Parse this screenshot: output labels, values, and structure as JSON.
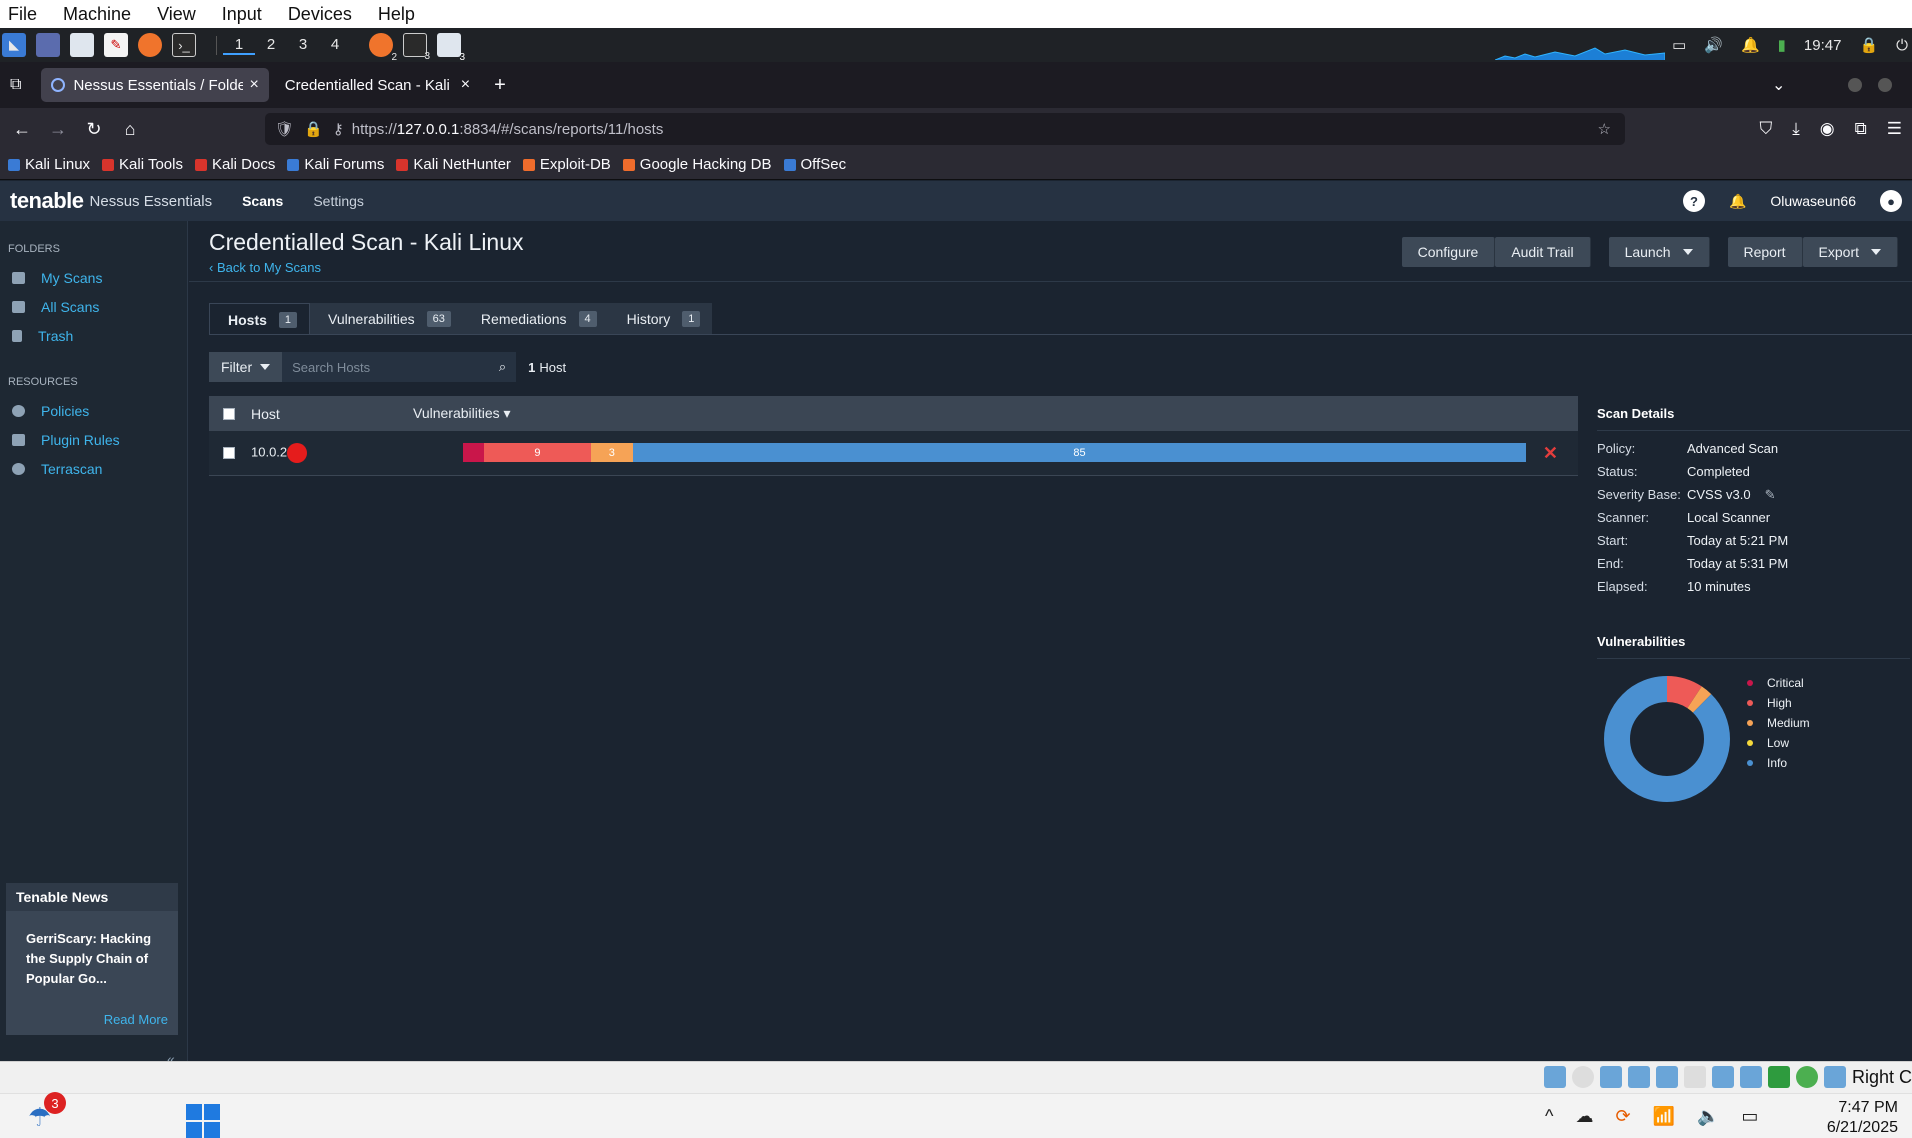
{
  "vbox_menu": [
    "File",
    "Machine",
    "View",
    "Input",
    "Devices",
    "Help"
  ],
  "kali_panel": {
    "workspaces": [
      "1",
      "2",
      "3",
      "4"
    ],
    "active_workspace": "1",
    "badges": [
      "2",
      "3",
      "3"
    ],
    "clock": "19:47"
  },
  "browser": {
    "tabs": [
      {
        "title": "Nessus Essentials / Folde",
        "active": true
      },
      {
        "title": "Credentialled Scan - Kali Linu",
        "active": false
      }
    ],
    "new_tab": "+",
    "url_prefix": "https://",
    "url_host": "127.0.0.1",
    "url_rest": ":8834/#/scans/reports/11/hosts",
    "bookmarks": [
      "Kali Linux",
      "Kali Tools",
      "Kali Docs",
      "Kali Forums",
      "Kali NetHunter",
      "Exploit-DB",
      "Google Hacking DB",
      "OffSec"
    ]
  },
  "nessus": {
    "logo": "tenable",
    "product": "Nessus Essentials",
    "nav": {
      "scans": "Scans",
      "settings": "Settings"
    },
    "help_icon": "?",
    "username": "Oluwaseun66"
  },
  "sidebar": {
    "folders_label": "FOLDERS",
    "folders": [
      "My Scans",
      "All Scans",
      "Trash"
    ],
    "resources_label": "RESOURCES",
    "resources": [
      "Policies",
      "Plugin Rules",
      "Terrascan"
    ],
    "news_title": "Tenable News",
    "news_body": "GerriScary: Hacking the Supply Chain of Popular Go...",
    "news_more": "Read More",
    "collapse": "«"
  },
  "page": {
    "title": "Credentialled Scan - Kali Linux",
    "back": "‹ Back to My Scans",
    "actions": {
      "configure": "Configure",
      "audit_trail": "Audit Trail",
      "launch": "Launch",
      "report": "Report",
      "export": "Export"
    }
  },
  "tabs": [
    {
      "label": "Hosts",
      "count": "1"
    },
    {
      "label": "Vulnerabilities",
      "count": "63"
    },
    {
      "label": "Remediations",
      "count": "4"
    },
    {
      "label": "History",
      "count": "1"
    }
  ],
  "filter": {
    "label": "Filter",
    "placeholder": "Search Hosts",
    "count_num": "1",
    "count_label": "Host"
  },
  "table": {
    "col_host": "Host",
    "col_vulns": "Vulnerabilities ▾",
    "row": {
      "host": "10.0.2.",
      "critical": "",
      "high": "9",
      "medium": "3",
      "info": "85",
      "delete": "✕"
    }
  },
  "vuln_bar_fractions": {
    "critical": 0.02,
    "high": 0.1,
    "medium": 0.04,
    "info": 0.84
  },
  "scan_details": {
    "title": "Scan Details",
    "rows": [
      {
        "k": "Policy:",
        "v": "Advanced Scan"
      },
      {
        "k": "Status:",
        "v": "Completed"
      },
      {
        "k": "Severity Base:",
        "v": "CVSS v3.0"
      },
      {
        "k": "Scanner:",
        "v": "Local Scanner"
      },
      {
        "k": "Start:",
        "v": "Today at 5:21 PM"
      },
      {
        "k": "End:",
        "v": "Today at 5:31 PM"
      },
      {
        "k": "Elapsed:",
        "v": "10 minutes"
      }
    ]
  },
  "vuln_chart": {
    "title": "Vulnerabilities",
    "legend": [
      "Critical",
      "High",
      "Medium",
      "Low",
      "Info"
    ],
    "colors": {
      "critical": "#c9164a",
      "high": "#ee5a57",
      "medium": "#f6a356",
      "low": "#f6d93b",
      "info": "#4a90d1"
    },
    "chart_data": {
      "type": "pie",
      "categories": [
        "Critical",
        "High",
        "Medium",
        "Low",
        "Info"
      ],
      "values": [
        0,
        9,
        3,
        0,
        85
      ]
    }
  },
  "vbox_status": {
    "host_key": "Right C"
  },
  "taskbar": {
    "badge": "3",
    "time": "7:47 PM",
    "date": "6/21/2025"
  }
}
